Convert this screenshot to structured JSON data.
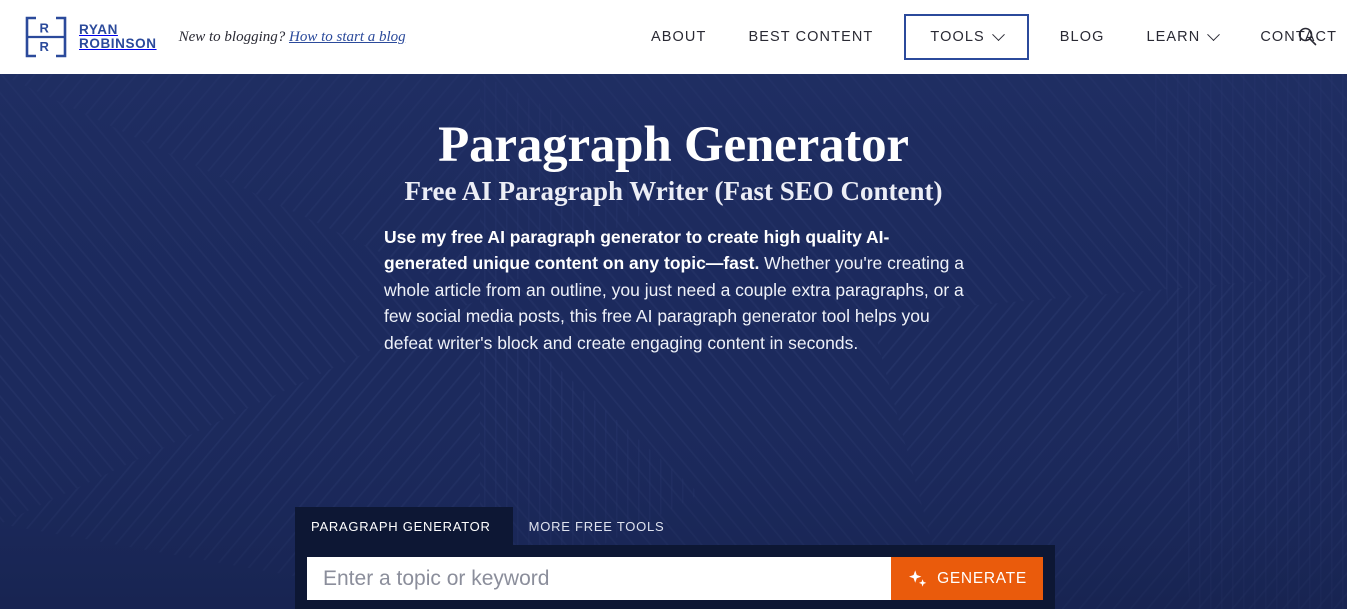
{
  "header": {
    "brand": {
      "icon": "logo-monogram-rr",
      "line1": "RYAN",
      "line2": "ROBINSON"
    },
    "tagline": {
      "text": "New to blogging?",
      "link_label": "How to start a blog"
    },
    "nav": [
      {
        "label": "ABOUT",
        "has_chevron": false,
        "boxed": false
      },
      {
        "label": "BEST CONTENT",
        "has_chevron": false,
        "boxed": false
      },
      {
        "label": "TOOLS",
        "has_chevron": true,
        "boxed": true
      },
      {
        "label": "BLOG",
        "has_chevron": false,
        "boxed": false
      },
      {
        "label": "LEARN",
        "has_chevron": true,
        "boxed": false
      },
      {
        "label": "CONTACT",
        "has_chevron": false,
        "boxed": false
      }
    ],
    "search_icon": "search-icon"
  },
  "hero": {
    "title": "Paragraph Generator",
    "subtitle": "Free AI Paragraph Writer (Fast SEO Content)",
    "lead_bold": "Use my free AI paragraph generator to create high quality AI-generated unique content on any topic—fast.",
    "lead_rest": " Whether you're creating a whole article from an outline, you just need a couple extra paragraphs, or a few social media posts, this free AI paragraph generator tool helps you defeat writer's block and create engaging content in seconds."
  },
  "tool": {
    "tabs": [
      {
        "label": "PARAGRAPH GENERATOR",
        "active": true
      },
      {
        "label": "MORE FREE TOOLS",
        "active": false
      }
    ],
    "input": {
      "placeholder": "Enter a topic or keyword",
      "value": ""
    },
    "generate_label": "GENERATE",
    "generate_icon": "sparkle-icon"
  },
  "colors": {
    "brand_blue": "#2b4a9b",
    "hero_navy": "#1c2a5d",
    "panel_navy": "#0d1734",
    "accent_orange": "#ea5b0c",
    "header_bg": "#ffffff",
    "nav_text": "#2a2a34"
  }
}
